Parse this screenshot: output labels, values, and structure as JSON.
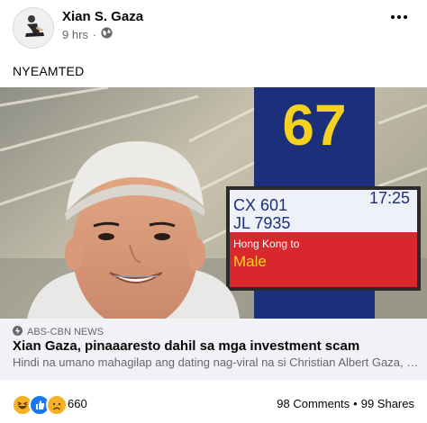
{
  "post": {
    "author": "Xian S. Gaza",
    "time": "9 hrs",
    "separator": "·",
    "caption": "NYEAMTED"
  },
  "photo": {
    "gate_number": "67",
    "flight_1": "CX 601",
    "flight_2": "JL 7935",
    "departure_time": "17:25",
    "route_from": "Hong Kong to",
    "route_to": "Male"
  },
  "link": {
    "source": "ABS-CBN NEWS",
    "headline": "Xian Gaza, pinaaaresto dahil sa mga investment scam",
    "description": "Hindi na umano mahagilap ang dating nag-viral na si Christian Albert Gaza, o mas..."
  },
  "footer": {
    "reaction_count": "660",
    "comments": "98 Comments",
    "dot": "•",
    "shares": "99 Shares"
  },
  "colors": {
    "brand_blue": "#1877f2",
    "reaction_yellow": "#f7b125",
    "text_secondary": "#65676b",
    "gate_sign_navy": "#1b2f7a",
    "gate_number_yellow": "#f4d21f",
    "sign_red": "#d9272e"
  },
  "icons": [
    "globe-icon",
    "more-options-icon",
    "haha-reaction-icon",
    "like-reaction-icon",
    "sad-reaction-icon",
    "news-source-icon"
  ]
}
